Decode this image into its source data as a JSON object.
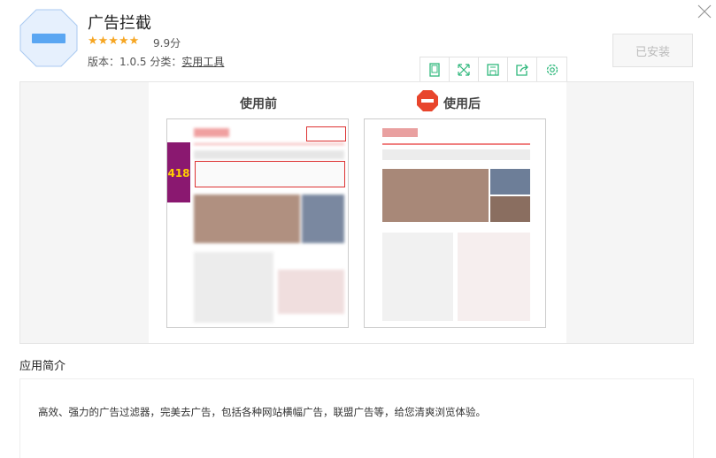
{
  "app": {
    "name": "广告拦截",
    "rating_stars": 5,
    "score": "9.9分",
    "version_label": "版本：",
    "version": "1.0.5",
    "category_label": "分类：",
    "category": "实用工具",
    "install_label": "已安装"
  },
  "toolbar": [
    {
      "icon": "tablet-icon"
    },
    {
      "icon": "fullscreen-icon"
    },
    {
      "icon": "save-icon"
    },
    {
      "icon": "share-icon"
    },
    {
      "icon": "settings-icon"
    }
  ],
  "screenshot": {
    "before_label": "使用前",
    "after_label": "使用后",
    "ad_text": "418"
  },
  "intro": {
    "title": "应用简介",
    "description": "高效、强力的广告过滤器，完美去广告，包括各种网站横幅广告，联盟广告等，给您清爽浏览体验。"
  },
  "colors": {
    "accent": "#2fb87c",
    "icon_blue": "#5aa6f2",
    "stop_red": "#e8452c"
  }
}
